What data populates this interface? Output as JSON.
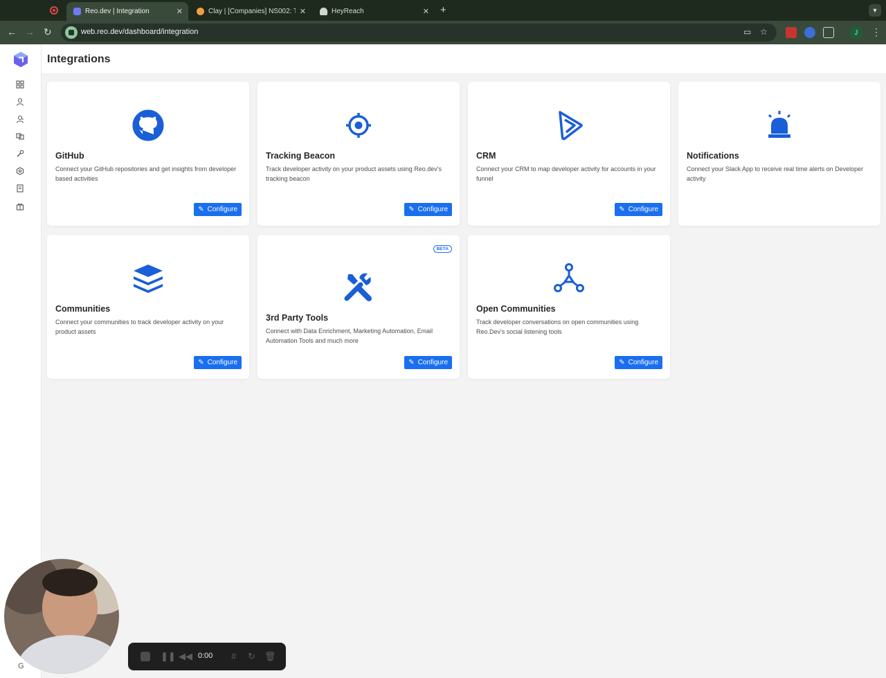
{
  "browser": {
    "tabs": [
      {
        "label": "Reo.dev | Integration",
        "active": true
      },
      {
        "label": "Clay | [Companies] NS002: T...",
        "active": false
      },
      {
        "label": "HeyReach",
        "active": false
      }
    ],
    "url": "web.reo.dev/dashboard/integration",
    "profile_initial": "J"
  },
  "sidebar": {
    "items": [
      {
        "icon": "dashboard-grid-icon"
      },
      {
        "icon": "user-icon"
      },
      {
        "icon": "developer-user-icon"
      },
      {
        "icon": "accounts-icon"
      },
      {
        "icon": "integrations-icon"
      },
      {
        "icon": "settings-icon"
      },
      {
        "icon": "reports-icon"
      },
      {
        "icon": "gift-icon"
      }
    ]
  },
  "page": {
    "title": "Integrations"
  },
  "cards": [
    {
      "title": "GitHub",
      "desc": "Connect your GitHub repositories and get insights from developer based activities",
      "button": "Configure",
      "icon": "github-icon"
    },
    {
      "title": "Tracking Beacon",
      "desc": "Track developer activity on your product assets using Reo.dev's tracking beacon",
      "button": "Configure",
      "icon": "target-icon"
    },
    {
      "title": "CRM",
      "desc": "Connect your CRM to map developer activity for accounts in your funnel",
      "button": "Configure",
      "icon": "play-icon"
    },
    {
      "title": "Notifications",
      "desc": "Connect your Slack App to receive real time alerts on Developer activity",
      "icon": "siren-icon"
    },
    {
      "title": "Communities",
      "desc": "Connect your communities to track developer activity on your product assets",
      "button": "Configure",
      "icon": "layers-icon"
    },
    {
      "title": "3rd Party Tools",
      "desc": "Connect with Data Enrichment, Marketing Automation, Email Automation Tools and much more",
      "button": "Configure",
      "badge": "BETA",
      "icon": "tools-icon"
    },
    {
      "title": "Open Communities",
      "desc": "Track developer conversations on open communities using Reo.Dev's social listening tools",
      "button": "Configure",
      "icon": "network-icon"
    }
  ],
  "recorder": {
    "time": "0:00"
  },
  "colors": {
    "accent": "#1a6ff0",
    "background": "#f3f3f3",
    "chrome": "#3a4a3a"
  }
}
